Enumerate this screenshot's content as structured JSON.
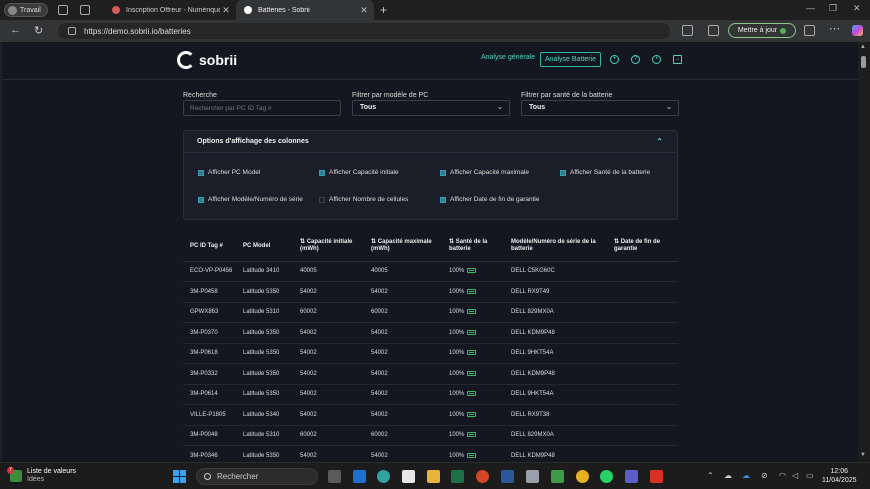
{
  "browser": {
    "profile_label": "Travail",
    "tabs": [
      {
        "label": "Inscription Offreur - Numérique ·",
        "active": false,
        "favicon_color": "#d65a5a"
      },
      {
        "label": "Batteries - Sobrii",
        "active": true,
        "favicon_color": "#ffffff"
      }
    ],
    "url": "https://demo.sobrii.io/batteries",
    "update_label": "Mettre à jour"
  },
  "app": {
    "logo_text": "sobrii",
    "nav": {
      "general": "Analyse générale",
      "battery": "Analyse Batterie"
    }
  },
  "filters": {
    "search_label": "Recherche",
    "search_placeholder": "Rechercher par PC ID Tag #",
    "model_label": "Filtrer par modèle de PC",
    "model_value": "Tous",
    "health_label": "Filtrer par santé de la batterie",
    "health_value": "Tous"
  },
  "options": {
    "title": "Options d'affichage des colonnes",
    "items": [
      {
        "label": "Afficher PC Model",
        "checked": true
      },
      {
        "label": "Afficher Capacité initiale",
        "checked": true
      },
      {
        "label": "Afficher Capacité maximale",
        "checked": true
      },
      {
        "label": "Afficher Santé de la batterie",
        "checked": true
      },
      {
        "label": "Afficher Modèle/Numéro de série",
        "checked": true
      },
      {
        "label": "Afficher Nombre de cellules",
        "checked": false
      },
      {
        "label": "Afficher Date de fin de garantie",
        "checked": true
      }
    ]
  },
  "table": {
    "headers": [
      [
        "PC ID Tag #"
      ],
      [
        "PC Model"
      ],
      [
        "⇅ Capacité initiale",
        "(mWh)"
      ],
      [
        "⇅ Capacité maximale",
        "(mWh)"
      ],
      [
        "⇅ Santé de la",
        "batterie"
      ],
      [
        "Modèle/Numéro de série de la",
        "batterie"
      ],
      [
        "⇅ Date de fin de",
        "garantie"
      ]
    ],
    "rows": [
      [
        "ECO-VP-P0456",
        "Latitude 3410",
        "40005",
        "40005",
        "100%",
        "DELL C5KG60C"
      ],
      [
        "3M-P0458",
        "Latitude 5350",
        "54002",
        "54002",
        "100%",
        "DELL RX9T49"
      ],
      [
        "GPWX863",
        "Latitude 5310",
        "60002",
        "60002",
        "100%",
        "DELL 829MX0A"
      ],
      [
        "3M-P0370",
        "Latitude 5350",
        "54002",
        "54002",
        "100%",
        "DELL KDM9P48"
      ],
      [
        "3M-P0618",
        "Latitude 5350",
        "54002",
        "54002",
        "100%",
        "DELL 9HKT54A"
      ],
      [
        "3M-P0332",
        "Latitude 5350",
        "54002",
        "54002",
        "100%",
        "DELL KDM9P48"
      ],
      [
        "3M-P0614",
        "Latitude 5350",
        "54002",
        "54002",
        "100%",
        "DELL 9HKT54A"
      ],
      [
        "VILLE-P1805",
        "Latitude 5340",
        "54002",
        "54002",
        "100%",
        "DELL RX9T38"
      ],
      [
        "3M-P0048",
        "Latitude 5310",
        "60002",
        "60002",
        "100%",
        "DELL 829MX0A"
      ],
      [
        "3M-P0346",
        "Latitude 5350",
        "54002",
        "54002",
        "100%",
        "DELL KDM9P48"
      ]
    ]
  },
  "taskbar": {
    "weather_title": "Liste de valeurs",
    "weather_sub": "Idées",
    "weather_badge": "7",
    "search": "Rechercher",
    "time": "12:06",
    "date": "11/04/2025"
  },
  "colors": {
    "accent": "#4fd3c1",
    "background": "#141720",
    "battery_ok": "#3dbb6a"
  }
}
